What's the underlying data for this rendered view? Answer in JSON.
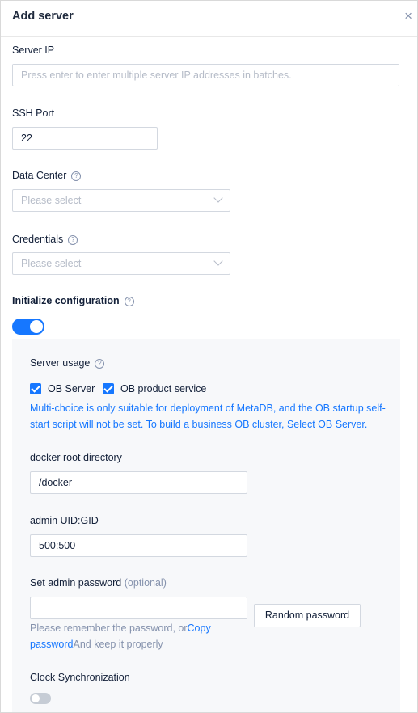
{
  "drawer": {
    "title": "Add server",
    "close_icon": "×"
  },
  "server_ip": {
    "label": "Server IP",
    "placeholder": "Press enter to enter multiple server IP addresses in batches."
  },
  "ssh_port": {
    "label": "SSH Port",
    "value": "22"
  },
  "data_center": {
    "label": "Data Center",
    "placeholder": "Please select"
  },
  "credentials": {
    "label": "Credentials",
    "placeholder": "Please select"
  },
  "init_config": {
    "label": "Initialize configuration",
    "enabled": true
  },
  "server_usage": {
    "label": "Server usage",
    "options": [
      {
        "label": "OB Server",
        "checked": true
      },
      {
        "label": "OB product service",
        "checked": true
      }
    ],
    "note": "Multi-choice is only suitable for deployment of MetaDB, and the OB startup self-start script will not be set. To build a business OB cluster, Select OB Server."
  },
  "docker_root": {
    "label": "docker root directory",
    "value": "/docker"
  },
  "admin_uid": {
    "label": "admin UID:GID",
    "value": "500:500"
  },
  "admin_password": {
    "label": "Set admin password",
    "optional": "(optional)",
    "value": "",
    "hint_prefix": "Please remember the password, or",
    "hint_link": "Copy password",
    "hint_suffix": "And keep it properly",
    "random_button": "Random password"
  },
  "clock_sync": {
    "label": "Clock Synchronization",
    "enabled": false
  },
  "colors": {
    "accent": "#1677ff",
    "text": "#132039",
    "muted": "#8592ad",
    "panel_bg": "#f7f8fa"
  }
}
